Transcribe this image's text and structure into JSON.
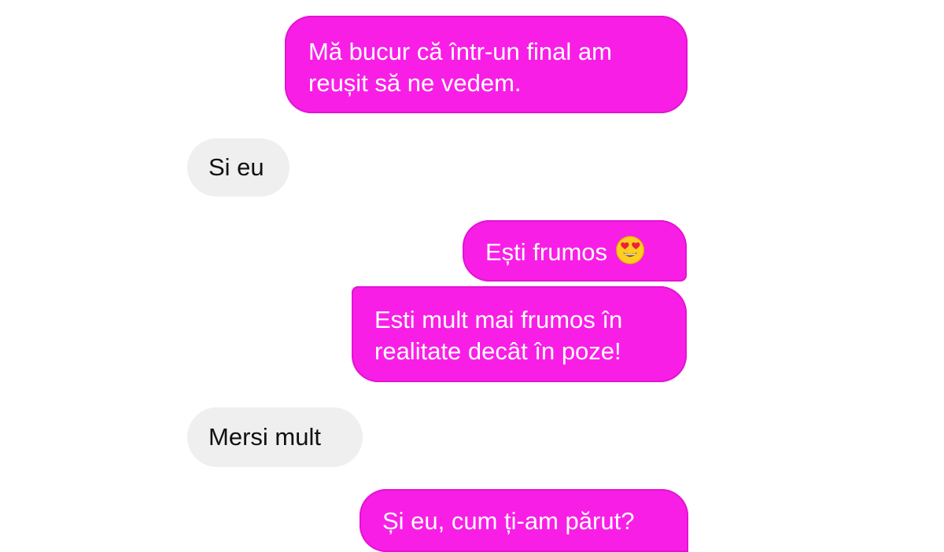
{
  "messages": [
    {
      "id": "m1",
      "side": "sent",
      "lines": [
        "Mă bucur că într-un final am",
        "reușit să ne vedem."
      ]
    },
    {
      "id": "m2",
      "side": "received",
      "lines": [
        "Si eu"
      ]
    },
    {
      "id": "m3",
      "side": "sent",
      "lines": [
        "Ești frumos"
      ],
      "emoji": "heart-eyes-emoji-icon"
    },
    {
      "id": "m4",
      "side": "sent",
      "lines": [
        "Esti mult mai frumos în",
        "realitate decât în poze!"
      ]
    },
    {
      "id": "m5",
      "side": "received",
      "lines": [
        "Mersi mult"
      ]
    },
    {
      "id": "m6",
      "side": "sent",
      "lines": [
        "Și eu, cum ți-am părut?"
      ]
    }
  ],
  "colors": {
    "sent_bubble": "#f91ee6",
    "sent_text": "#ffffff",
    "received_bubble": "#efefef",
    "received_text": "#111111",
    "background": "#ffffff"
  }
}
